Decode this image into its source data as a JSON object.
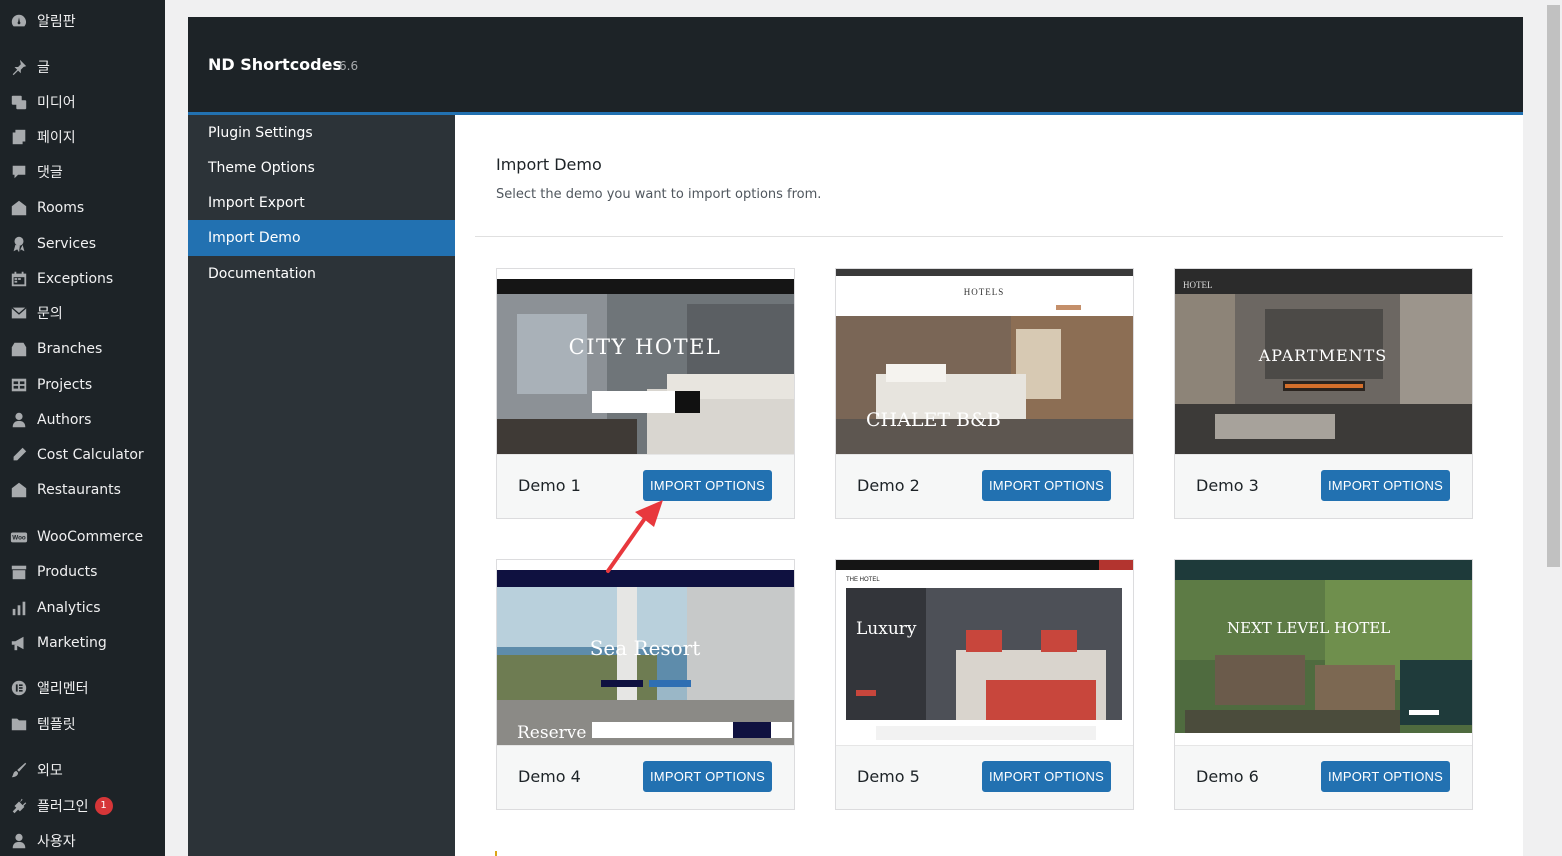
{
  "admin_menu": [
    {
      "name": "dashboard",
      "icon": "dashboard-icon",
      "label": "알림판"
    },
    {
      "name": "posts",
      "icon": "pin-icon",
      "label": "글"
    },
    {
      "name": "media",
      "icon": "media-icon",
      "label": "미디어"
    },
    {
      "name": "pages",
      "icon": "pages-icon",
      "label": "페이지"
    },
    {
      "name": "comments",
      "icon": "comments-icon",
      "label": "댓글"
    },
    {
      "name": "rooms",
      "icon": "building-icon",
      "label": "Rooms"
    },
    {
      "name": "services",
      "icon": "award-icon",
      "label": "Services"
    },
    {
      "name": "exceptions",
      "icon": "calendar-icon",
      "label": "Exceptions"
    },
    {
      "name": "inquiry",
      "icon": "email-icon",
      "label": "문의"
    },
    {
      "name": "branches",
      "icon": "store-icon",
      "label": "Branches"
    },
    {
      "name": "projects",
      "icon": "portfolio-icon",
      "label": "Projects"
    },
    {
      "name": "authors",
      "icon": "user-icon",
      "label": "Authors"
    },
    {
      "name": "cost-calculator",
      "icon": "pencil-icon",
      "label": "Cost Calculator"
    },
    {
      "name": "restaurants",
      "icon": "building-icon",
      "label": "Restaurants"
    },
    {
      "name": "woocommerce",
      "icon": "woo-icon",
      "label": "WooCommerce"
    },
    {
      "name": "products",
      "icon": "archive-icon",
      "label": "Products"
    },
    {
      "name": "analytics",
      "icon": "bar-chart-icon",
      "label": "Analytics"
    },
    {
      "name": "marketing",
      "icon": "megaphone-icon",
      "label": "Marketing"
    },
    {
      "name": "elementor",
      "icon": "elementor-icon",
      "label": "앨리멘터"
    },
    {
      "name": "templates",
      "icon": "folder-icon",
      "label": "템플릿"
    },
    {
      "name": "appearance",
      "icon": "brush-icon",
      "label": "외모"
    },
    {
      "name": "plugins",
      "icon": "plugin-icon",
      "label": "플러그인",
      "badge": "1"
    },
    {
      "name": "users",
      "icon": "users-icon",
      "label": "사용자"
    }
  ],
  "plugin": {
    "title": "ND Shortcodes",
    "version": "6.6",
    "nav": [
      "Plugin Settings",
      "Theme Options",
      "Import Export",
      "Import Demo",
      "Documentation"
    ],
    "active_nav": "Import Demo"
  },
  "import_demo": {
    "heading": "Import Demo",
    "description": "Select the demo you want to import options from.",
    "button_label": "IMPORT OPTIONS",
    "demos": [
      {
        "name": "Demo 1",
        "preview_title": "CITY HOTEL"
      },
      {
        "name": "Demo 2",
        "preview_title": "CHALET B&B"
      },
      {
        "name": "Demo 3",
        "preview_title": "APARTMENTS"
      },
      {
        "name": "Demo 4",
        "preview_title": "Sea Resort"
      },
      {
        "name": "Demo 5",
        "preview_title": "Luxury"
      },
      {
        "name": "Demo 6",
        "preview_title": "NEXT LEVEL HOTEL"
      }
    ]
  },
  "preview_extra": {
    "demo4_reserve": "Reserve !",
    "demo2_logo": "HOTELS",
    "demo3_logo": "HOTEL",
    "demo5_logo": "THE HOTEL"
  },
  "colors": {
    "sidebar_bg": "#1d2327",
    "accent_blue": "#2271b1",
    "annotation_arrow": "#e8383d"
  }
}
